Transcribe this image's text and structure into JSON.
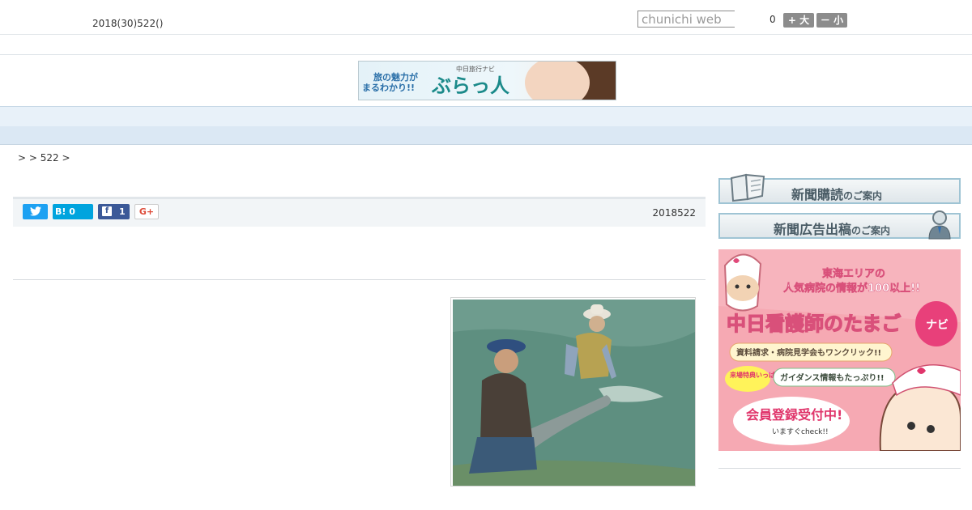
{
  "header": {
    "date_line": "2018(30)522()",
    "search_placeholder": "chunichi web",
    "font_size_value": "0",
    "font_up_label": "+ 大",
    "font_down_label": "－ 小"
  },
  "banner": {
    "line1": "旅の魅力が",
    "line2": "まるわかり!!",
    "small": "中日旅行ナビ",
    "title": "ぶらっ人"
  },
  "nav": {
    "items": [
      "",
      "",
      "",
      "",
      "",
      "",
      "",
      "",
      ""
    ]
  },
  "breadcrumb": ">  > 522 >",
  "share": {
    "twitter_icon": "twitter-bird",
    "hatena_label": "B! 0",
    "facebook_icon": "f",
    "facebook_count": "1",
    "gplus_label": "G+"
  },
  "article": {
    "date": "2018522"
  },
  "sidebar": {
    "subscribe_main": "新聞購読",
    "subscribe_suffix": "のご案内",
    "ad_main": "新聞広告出稿",
    "ad_suffix": "のご案内",
    "nurse_ad": {
      "line1": "東海エリアの",
      "line2": "人気病院の情報が100以上!!",
      "title": "中日看護師のたまご",
      "navi": "ナビ",
      "pill1": "資料請求・病院見学会もワンクリック!!",
      "badge": "来場特典いっぱい",
      "pill2": "ガイダンス情報もたっぷり!!",
      "bubble_main": "会員登録受付中!",
      "bubble_sub": "いますぐcheck!!"
    }
  },
  "colors": {
    "nav_bg": "#e8f1f9",
    "twitter": "#1da1f2",
    "hatena": "#00a4de",
    "facebook": "#3b5998",
    "gplus": "#dd4b39",
    "nurse_pink": "#f6a8b2"
  }
}
